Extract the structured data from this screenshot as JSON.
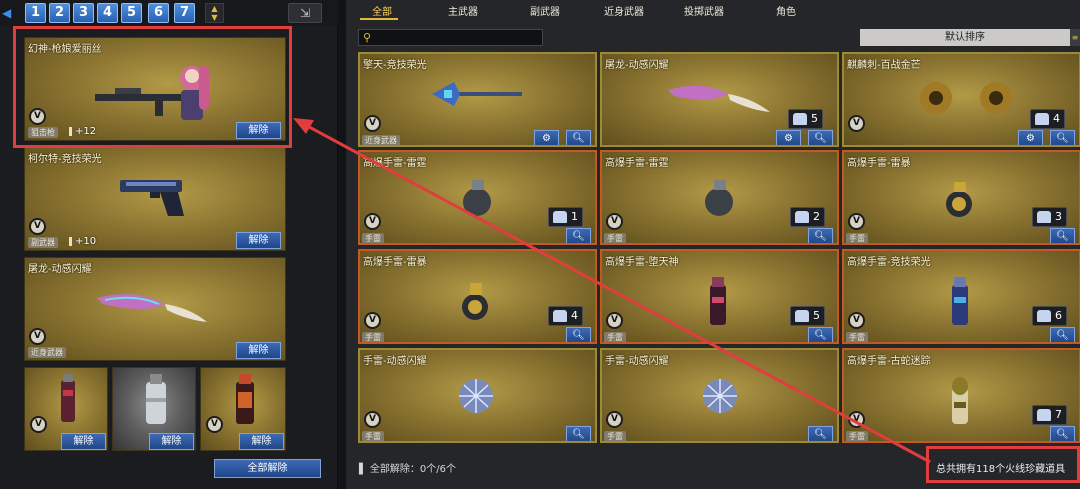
{
  "slots": [
    "1",
    "2",
    "3",
    "4",
    "5",
    "6",
    "7"
  ],
  "left_items": [
    {
      "name": "幻神-枪娘爱丽丝",
      "type": "狙击枪",
      "count": "+12",
      "unequip": "解除"
    },
    {
      "name": "柯尔特-竞技荣光",
      "type": "副武器",
      "count": "+10",
      "unequip": "解除"
    },
    {
      "name": "屠龙-动感闪耀",
      "type": "近身武器",
      "unequip": "解除"
    }
  ],
  "grenade_slots": [
    {
      "unequip": "解除"
    },
    {
      "unequip": "解除"
    },
    {
      "unequip": "解除"
    }
  ],
  "all_unequip": "全部解除",
  "badge_letter": "V",
  "tabs": [
    "全部",
    "主武器",
    "副武器",
    "近身武器",
    "投掷武器",
    "角色"
  ],
  "sort_label": "默认排序",
  "items": [
    {
      "name": "擎天-竞技荣光",
      "type": "近身武器",
      "count": "",
      "border": "gold"
    },
    {
      "name": "屠龙-动感闪耀",
      "type": "",
      "count": "5",
      "border": "gold"
    },
    {
      "name": "麒麟刺-百战金芒",
      "type": "",
      "count": "4",
      "border": "gold"
    },
    {
      "name": "高爆手雷-雷霆",
      "type": "手雷",
      "count": "1",
      "border": "orange"
    },
    {
      "name": "高爆手雷-雷霆",
      "type": "手雷",
      "count": "2",
      "border": "orange"
    },
    {
      "name": "高爆手雷-雷暴",
      "type": "手雷",
      "count": "3",
      "border": "orange"
    },
    {
      "name": "高爆手雷-雷暴",
      "type": "手雷",
      "count": "4",
      "border": "orange"
    },
    {
      "name": "高爆手雷-堕天神",
      "type": "手雷",
      "count": "5",
      "border": "orange"
    },
    {
      "name": "高爆手雷-竞技荣光",
      "type": "手雷",
      "count": "6",
      "border": "orange"
    },
    {
      "name": "手雷-动感闪耀",
      "type": "手雷",
      "count": "",
      "border": "gold"
    },
    {
      "name": "手雷-动感闪耀",
      "type": "手雷",
      "count": "",
      "border": "gold"
    },
    {
      "name": "高爆手雷-古蛇迷踪",
      "type": "手雷",
      "count": "7",
      "border": "orange"
    }
  ],
  "footer_left": "全部解除：0个/6个",
  "footer_right": "总共拥有118个火线珍藏道具"
}
